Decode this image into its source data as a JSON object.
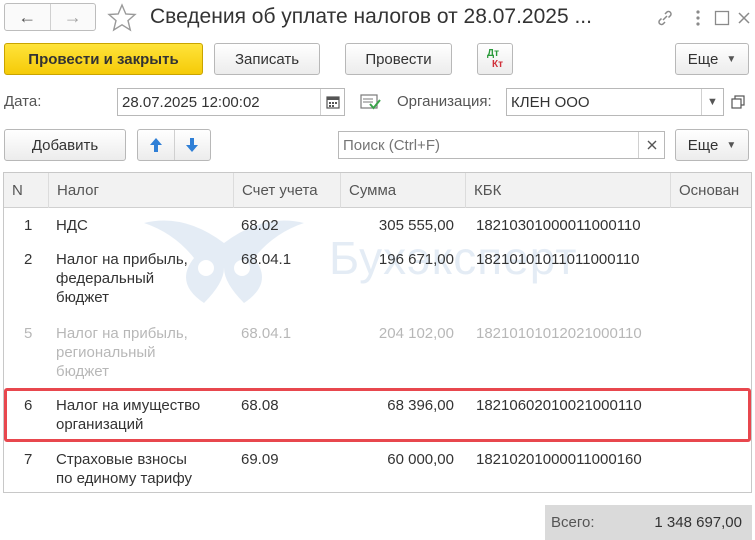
{
  "window": {
    "title": "Сведения об уплате налогов от 28.07.2025 ..."
  },
  "toolbar": {
    "post_close_label": "Провести и закрыть",
    "save_label": "Записать",
    "post_label": "Провести",
    "dt_label": "Дт",
    "kt_label": "Кт",
    "more_label": "Еще"
  },
  "form": {
    "date_label": "Дата:",
    "date_value": "28.07.2025 12:00:02",
    "org_label": "Организация:",
    "org_value": "КЛЕН ООО"
  },
  "table_toolbar": {
    "add_label": "Добавить",
    "search_placeholder": "Поиск (Ctrl+F)",
    "more_label": "Еще"
  },
  "table": {
    "columns": [
      "N",
      "Налог",
      "Счет учета",
      "Сумма",
      "КБК",
      "Основан"
    ],
    "rows": [
      {
        "n": "1",
        "tax": [
          "НДС"
        ],
        "account": "68.02",
        "sum": "305 555,00",
        "kbk": "18210301000011000110"
      },
      {
        "n": "2",
        "tax": [
          "Налог на прибыль,",
          "федеральный",
          "бюджет"
        ],
        "account": "68.04.1",
        "sum": "196 671,00",
        "kbk": "18210101011011000110"
      },
      {
        "n": "5",
        "tax": [
          "Налог на прибыль,",
          "региональный",
          "бюджет"
        ],
        "account": "68.04.1",
        "sum": "204 102,00",
        "kbk": "18210101012021000110"
      },
      {
        "n": "6",
        "tax": [
          "Налог на имущество",
          "организаций"
        ],
        "account": "68.08",
        "sum": "68 396,00",
        "kbk": "18210602010021000110"
      },
      {
        "n": "7",
        "tax": [
          "Страховые взносы",
          "по единому тарифу"
        ],
        "account": "69.09",
        "sum": "60 000,00",
        "kbk": "18210201000011000160"
      }
    ]
  },
  "watermark": {
    "text": "Бухэксперт"
  },
  "footer": {
    "total_label": "Всего:",
    "total_value": "1 348 697,00"
  },
  "colors": {
    "primary_button": "#f5cb08",
    "highlight_border": "#e8474e",
    "arrow_blue": "#2f7fd6"
  }
}
